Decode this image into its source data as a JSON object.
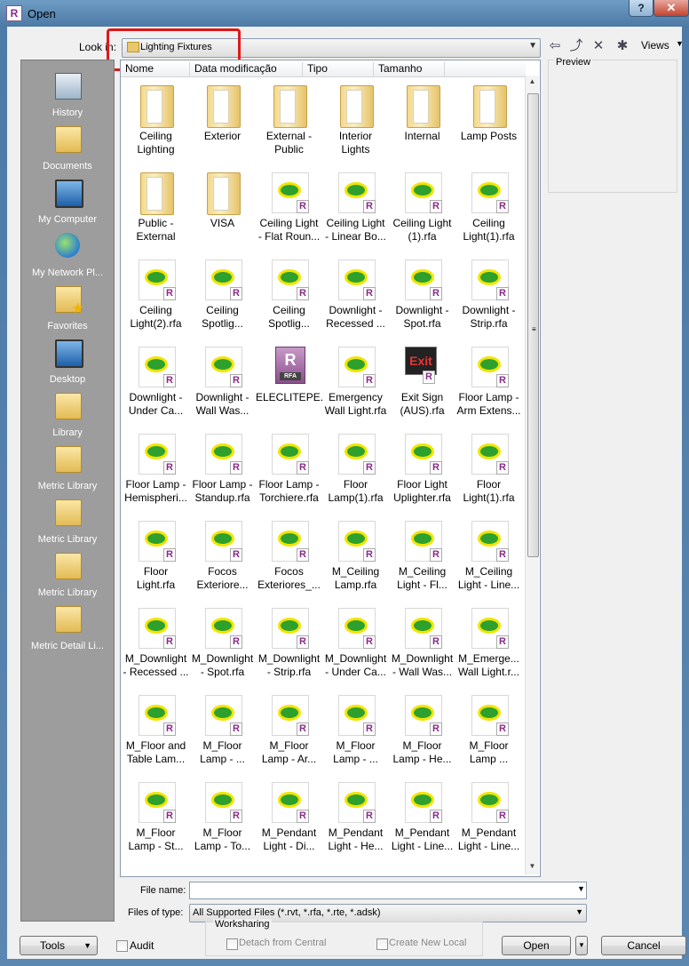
{
  "window": {
    "title": "Open",
    "help": "?",
    "close": "✕"
  },
  "lookin": {
    "label": "Look in:",
    "value": "Lighting Fixtures"
  },
  "views": {
    "label": "Views"
  },
  "preview": {
    "label": "Preview"
  },
  "places": [
    "History",
    "Documents",
    "My Computer",
    "My Network Pl...",
    "Favorites",
    "Desktop",
    "Library",
    "Metric Library",
    "Metric Library",
    "Metric Library",
    "Metric Detail Li..."
  ],
  "columns": [
    "Nome",
    "Data modificação",
    "Tipo",
    "Tamanho"
  ],
  "items": [
    {
      "l1": "Ceiling",
      "l2": "Lighting",
      "kind": "folder"
    },
    {
      "l1": "Exterior",
      "l2": "",
      "kind": "folder"
    },
    {
      "l1": "External -",
      "l2": "Public",
      "kind": "folder"
    },
    {
      "l1": "Interior",
      "l2": "Lights",
      "kind": "folder"
    },
    {
      "l1": "Internal",
      "l2": "",
      "kind": "folder"
    },
    {
      "l1": "Lamp Posts",
      "l2": "",
      "kind": "folder"
    },
    {
      "l1": "Public -",
      "l2": "External",
      "kind": "folder"
    },
    {
      "l1": "VISA",
      "l2": "",
      "kind": "folder"
    },
    {
      "l1": "Ceiling Light",
      "l2": "- Flat Roun...",
      "kind": "rfa"
    },
    {
      "l1": "Ceiling Light",
      "l2": "- Linear Bo...",
      "kind": "rfa"
    },
    {
      "l1": "Ceiling Light",
      "l2": "(1).rfa",
      "kind": "rfa"
    },
    {
      "l1": "Ceiling",
      "l2": "Light(1).rfa",
      "kind": "rfa"
    },
    {
      "l1": "Ceiling",
      "l2": "Light(2).rfa",
      "kind": "rfa"
    },
    {
      "l1": "Ceiling",
      "l2": "Spotlig...",
      "kind": "rfa"
    },
    {
      "l1": "Ceiling",
      "l2": "Spotlig...",
      "kind": "rfa"
    },
    {
      "l1": "Downlight -",
      "l2": "Recessed ...",
      "kind": "rfa"
    },
    {
      "l1": "Downlight -",
      "l2": "Spot.rfa",
      "kind": "rfa"
    },
    {
      "l1": "Downlight -",
      "l2": "Strip.rfa",
      "kind": "rfa"
    },
    {
      "l1": "Downlight -",
      "l2": "Under Ca...",
      "kind": "rfa"
    },
    {
      "l1": "Downlight -",
      "l2": "Wall Was...",
      "kind": "rfa"
    },
    {
      "l1": "ELECLITEPE...",
      "l2": "",
      "kind": "big"
    },
    {
      "l1": "Emergency",
      "l2": "Wall Light.rfa",
      "kind": "rfa"
    },
    {
      "l1": "Exit Sign",
      "l2": "(AUS).rfa",
      "kind": "exit"
    },
    {
      "l1": "Floor Lamp -",
      "l2": "Arm Extens...",
      "kind": "rfa"
    },
    {
      "l1": "Floor Lamp -",
      "l2": "Hemispheri...",
      "kind": "rfa"
    },
    {
      "l1": "Floor Lamp -",
      "l2": "Standup.rfa",
      "kind": "rfa"
    },
    {
      "l1": "Floor Lamp -",
      "l2": "Torchiere.rfa",
      "kind": "rfa"
    },
    {
      "l1": "Floor",
      "l2": "Lamp(1).rfa",
      "kind": "rfa"
    },
    {
      "l1": "Floor Light",
      "l2": "Uplighter.rfa",
      "kind": "rfa"
    },
    {
      "l1": "Floor",
      "l2": "Light(1).rfa",
      "kind": "rfa"
    },
    {
      "l1": "Floor",
      "l2": "Light.rfa",
      "kind": "rfa"
    },
    {
      "l1": "Focos",
      "l2": "Exteriore...",
      "kind": "rfa"
    },
    {
      "l1": "Focos",
      "l2": "Exteriores_...",
      "kind": "rfa"
    },
    {
      "l1": "M_Ceiling",
      "l2": "Lamp.rfa",
      "kind": "rfa"
    },
    {
      "l1": "M_Ceiling",
      "l2": "Light - Fl...",
      "kind": "rfa"
    },
    {
      "l1": "M_Ceiling",
      "l2": "Light - Line...",
      "kind": "rfa"
    },
    {
      "l1": "M_Downlight",
      "l2": "- Recessed ...",
      "kind": "rfa"
    },
    {
      "l1": "M_Downlight",
      "l2": "- Spot.rfa",
      "kind": "rfa"
    },
    {
      "l1": "M_Downlight",
      "l2": "- Strip.rfa",
      "kind": "rfa"
    },
    {
      "l1": "M_Downlight",
      "l2": "- Under Ca...",
      "kind": "rfa"
    },
    {
      "l1": "M_Downlight",
      "l2": "- Wall Was...",
      "kind": "rfa"
    },
    {
      "l1": "M_Emerge...",
      "l2": "Wall Light.r...",
      "kind": "rfa"
    },
    {
      "l1": "M_Floor and",
      "l2": "Table Lam...",
      "kind": "rfa"
    },
    {
      "l1": "M_Floor",
      "l2": "Lamp - ...",
      "kind": "rfa"
    },
    {
      "l1": "M_Floor",
      "l2": "Lamp - Ar...",
      "kind": "rfa"
    },
    {
      "l1": "M_Floor",
      "l2": "Lamp - ...",
      "kind": "rfa"
    },
    {
      "l1": "M_Floor",
      "l2": "Lamp - He...",
      "kind": "rfa"
    },
    {
      "l1": "M_Floor",
      "l2": "Lamp ...",
      "kind": "rfa"
    },
    {
      "l1": "M_Floor",
      "l2": "Lamp - St...",
      "kind": "rfa"
    },
    {
      "l1": "M_Floor",
      "l2": "Lamp - To...",
      "kind": "rfa"
    },
    {
      "l1": "M_Pendant",
      "l2": "Light - Di...",
      "kind": "rfa"
    },
    {
      "l1": "M_Pendant",
      "l2": "Light - He...",
      "kind": "rfa"
    },
    {
      "l1": "M_Pendant",
      "l2": "Light - Line...",
      "kind": "rfa"
    },
    {
      "l1": "M_Pendant",
      "l2": "Light - Line...",
      "kind": "rfa"
    }
  ],
  "filename": {
    "label": "File name:",
    "value": ""
  },
  "filetype": {
    "label": "Files of type:",
    "value": "All Supported Files  (*.rvt,  *.rfa,  *.rte,  *.adsk)"
  },
  "buttons": {
    "tools": "Tools",
    "open": "Open",
    "cancel": "Cancel"
  },
  "audit": {
    "label": "Audit"
  },
  "worksharing": {
    "title": "Worksharing",
    "detach": "Detach from Central",
    "local": "Create New Local"
  }
}
